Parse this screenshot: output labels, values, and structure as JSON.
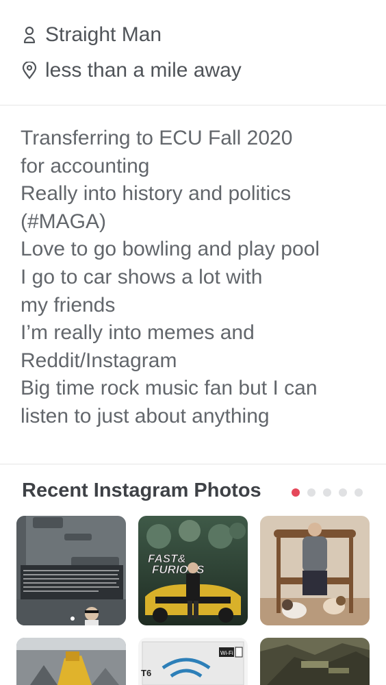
{
  "profile": {
    "orientation": {
      "icon": "person-outline-icon",
      "text": "Straight Man"
    },
    "distance": {
      "icon": "location-pin-icon",
      "text": "less than a mile away"
    }
  },
  "bio": {
    "lines": [
      "Transferring to ECU Fall 2020",
      "for accounting",
      "Really into history and politics",
      "(#MAGA)",
      "Love to go bowling and play pool",
      "I go to car shows a lot with",
      "my friends",
      "I’m really into memes and",
      "Reddit/Instagram",
      "Big time rock music fan but I can",
      "listen to just about anything"
    ]
  },
  "instagram": {
    "title": "Recent Instagram Photos",
    "page_count": 5,
    "active_page": 1,
    "photos": [
      {
        "desc": "meme-screenshot-photo",
        "caption": "This right here! +100 respect. Guy Tbagged me every time he killed me in the game for seemingly no reason (I went out of my way to kill him after that). Be like this guy. If it was a mistaken identity make amends don't be rude"
      },
      {
        "desc": "fast-furious-poster-photo",
        "logo_line1": "FAST&",
        "logo_line2": "FURIOUS"
      },
      {
        "desc": "man-with-dogs-photo"
      },
      {
        "desc": "bumblebee-robot-photo"
      },
      {
        "desc": "wifi-camera-box-photo",
        "label_a": "T6",
        "label_b": "Wi-Fi"
      },
      {
        "desc": "robot-wreckage-photo"
      }
    ]
  },
  "colors": {
    "accent": "#e5485a",
    "text": "#505459",
    "divider": "#e6e6e6"
  }
}
